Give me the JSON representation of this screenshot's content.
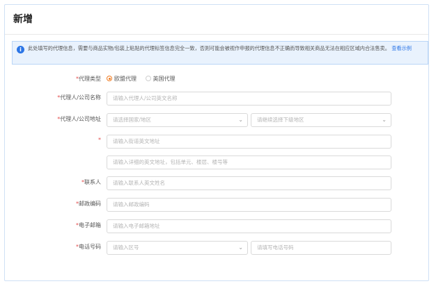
{
  "page": {
    "title": "新增"
  },
  "notice": {
    "text": "此处填写的代理信息，需要与商品实物/包装上粘贴的代理标签信息完全一致，否则可能会被视作申报的代理信息不正确而导致相关商品无法在相应区域内合法售卖。",
    "link_label": "查看示例",
    "icon": "info-icon"
  },
  "form": {
    "agent_type": {
      "label": "代理类型",
      "options": [
        {
          "label": "欧盟代理",
          "selected": true
        },
        {
          "label": "英国代理",
          "selected": false
        }
      ]
    },
    "company_name": {
      "label": "代理人/公司名称",
      "placeholder": "请输入代理人/公司英文名称"
    },
    "company_address": {
      "label": "代理人/公司地址",
      "country_placeholder": "请选择国家/地区",
      "region_placeholder": "请继续选择下级地区"
    },
    "street": {
      "label": "",
      "placeholder": "请输入街道英文地址"
    },
    "detail_address": {
      "placeholder": "请输入详细的英文地址，包括单元、楼层、楼号等"
    },
    "contact": {
      "label": "联系人",
      "placeholder": "请输入联系人英文姓名"
    },
    "postcode": {
      "label": "邮政编码",
      "placeholder": "请输入邮政编码"
    },
    "email": {
      "label": "电子邮箱",
      "placeholder": "请输入电子邮箱地址"
    },
    "phone": {
      "label": "电话号码",
      "area_placeholder": "请输入区号",
      "number_placeholder": "请填写电话号码"
    }
  },
  "colors": {
    "required": "#e34d4d",
    "accent": "#2b75e6",
    "radio_selected": "#f07a1f"
  }
}
